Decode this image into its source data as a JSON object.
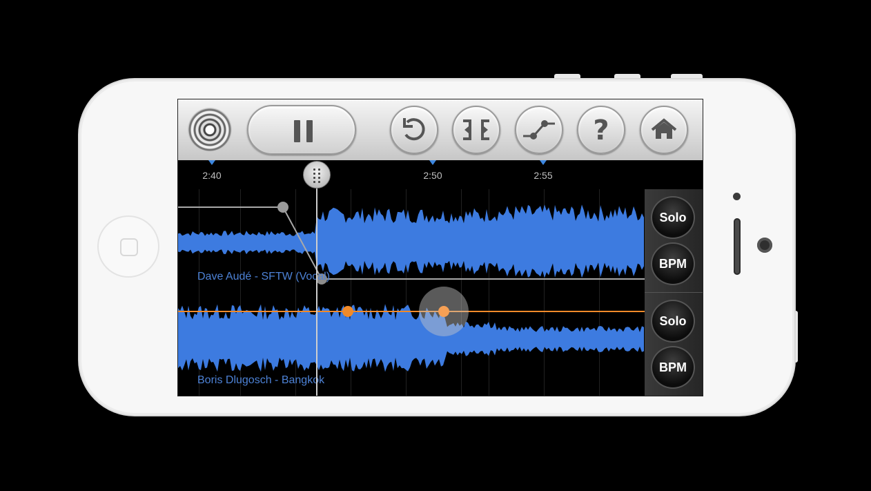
{
  "toolbar": {
    "play_state": "pause",
    "icons": [
      "app-logo-icon",
      "pause-icon",
      "undo-icon",
      "split-icon",
      "crossfade-icon",
      "help-icon",
      "home-icon"
    ]
  },
  "timeline": {
    "ticks": [
      "2:40",
      "2:50",
      "2:55"
    ]
  },
  "tracks": [
    {
      "name": "Dave Audé - SFTW (Vocal)",
      "solo_label": "Solo",
      "bpm_label": "BPM"
    },
    {
      "name": "Boris Dlugosch - Bangkok",
      "solo_label": "Solo",
      "bpm_label": "BPM"
    }
  ],
  "colors": {
    "waveform": "#3d7be0",
    "automation_orange": "#f08a2a",
    "automation_gray": "#a9a9a9"
  }
}
